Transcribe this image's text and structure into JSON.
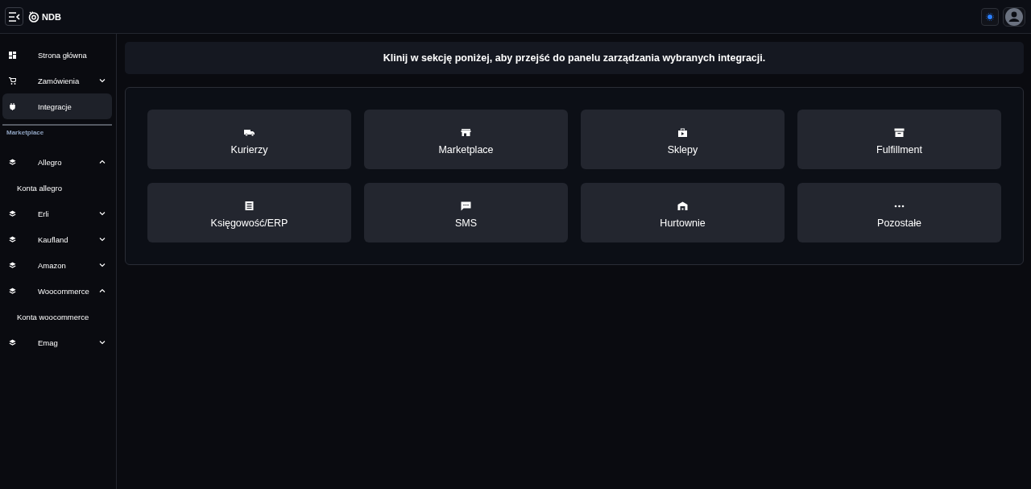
{
  "header": {
    "logo": "NDB"
  },
  "sidebar": {
    "items": [
      {
        "label": "Strona główna",
        "selected": false
      },
      {
        "label": "Zamówienia",
        "selected": false,
        "expanded": false
      },
      {
        "label": "Integracje",
        "selected": true
      }
    ],
    "section_title": "Marketplace",
    "marketplace_items": [
      {
        "label": "Allegro",
        "selected": false,
        "expanded": true,
        "children": [
          {
            "label": "Konta allegro",
            "selected": false
          }
        ]
      },
      {
        "label": "Erli",
        "selected": false,
        "expanded": false
      },
      {
        "label": "Kaufland",
        "selected": false,
        "expanded": false
      },
      {
        "label": "Amazon",
        "selected": false,
        "expanded": false
      },
      {
        "label": "Woocommerce",
        "selected": false,
        "expanded": true,
        "children": [
          {
            "label": "Konta woocommerce",
            "selected": false
          }
        ]
      },
      {
        "label": "Emag",
        "selected": false,
        "expanded": false
      }
    ]
  },
  "banner": "Klinij w sekcję poniżej, aby przejść do panelu zarządzania wybranych integracji.",
  "categories": [
    {
      "label": "Kurierzy"
    },
    {
      "label": "Marketplace"
    },
    {
      "label": "Sklepy"
    },
    {
      "label": "Fulfillment"
    },
    {
      "label": "Księgowość/ERP"
    },
    {
      "label": "SMS"
    },
    {
      "label": "Hurtownie"
    },
    {
      "label": "Pozostałe"
    }
  ]
}
